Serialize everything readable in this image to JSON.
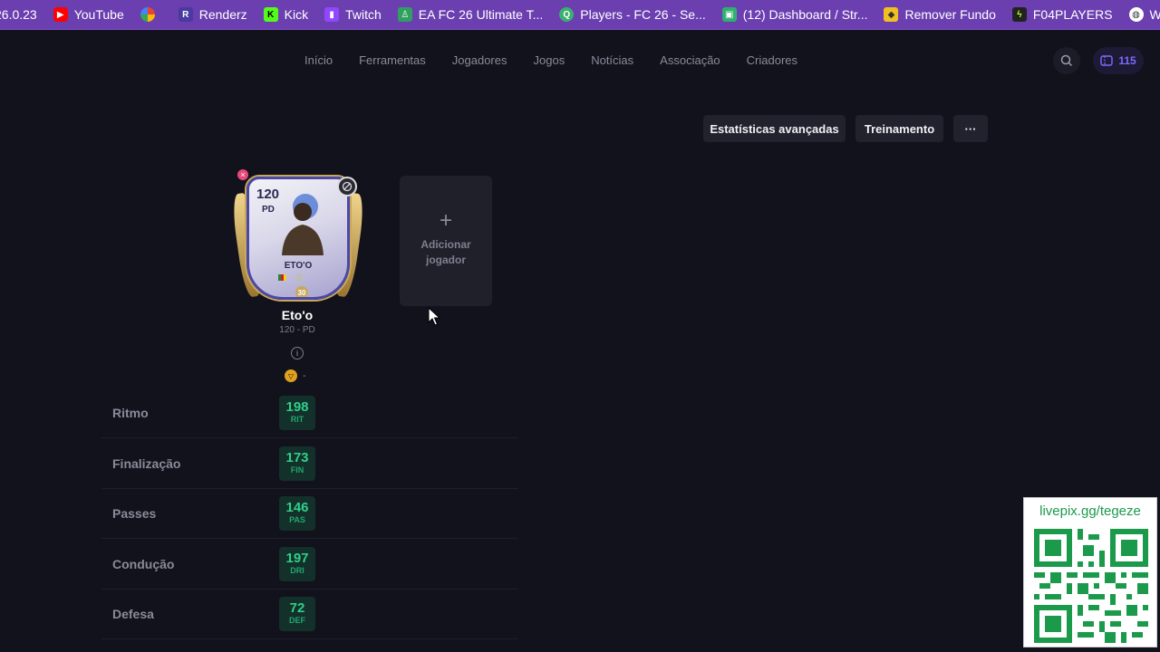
{
  "bookmarks": [
    {
      "label": "26.0.23",
      "icon": "bookmark-icon",
      "color": "#6b3fb0"
    },
    {
      "label": "YouTube",
      "icon": "youtube-icon",
      "color": "#ff0000"
    },
    {
      "label": "",
      "icon": "pinwheel-icon",
      "color": "#e0a020"
    },
    {
      "label": "Renderz",
      "icon": "renderz-icon",
      "color": "#4a3aa0"
    },
    {
      "label": "Kick",
      "icon": "kick-icon",
      "color": "#53fc18"
    },
    {
      "label": "Twitch",
      "icon": "twitch-icon",
      "color": "#9146ff"
    },
    {
      "label": "EA FC 26 Ultimate T...",
      "icon": "ea-icon",
      "color": "#2fa060"
    },
    {
      "label": "Players - FC 26 - Se...",
      "icon": "futbin-icon",
      "color": "#3ab070"
    },
    {
      "label": "(12) Dashboard / Str...",
      "icon": "dashboard-icon",
      "color": "#2fb070"
    },
    {
      "label": "Remover Fundo",
      "icon": "remover-icon",
      "color": "#f0c020"
    },
    {
      "label": "F04PLAYERS",
      "icon": "f04-icon",
      "color": "#222222"
    },
    {
      "label": "Web Ap",
      "icon": "globe-icon",
      "color": "#444444"
    }
  ],
  "nav": {
    "links": [
      "Início",
      "Ferramentas",
      "Jogadores",
      "Jogos",
      "Notícias",
      "Associação",
      "Criadores"
    ],
    "coins": "115"
  },
  "actions": {
    "advanced_stats": "Estatísticas avançadas",
    "training": "Treinamento",
    "more": "···"
  },
  "card": {
    "rating": "120",
    "position": "PD",
    "card_name": "ETO'O",
    "chemistry": "30"
  },
  "player": {
    "name": "Eto'o",
    "subtitle": "120 - PD",
    "chem_style": "-"
  },
  "add_player": {
    "plus": "+",
    "label": "Adicionar jogador"
  },
  "stats": [
    {
      "label": "Ritmo",
      "value": "198",
      "abbr": "RIT"
    },
    {
      "label": "Finalização",
      "value": "173",
      "abbr": "FIN"
    },
    {
      "label": "Passes",
      "value": "146",
      "abbr": "PAS"
    },
    {
      "label": "Condução",
      "value": "197",
      "abbr": "DRI"
    },
    {
      "label": "Defesa",
      "value": "72",
      "abbr": "DEF"
    }
  ],
  "qr": {
    "url": "livepix.gg/tegeze"
  },
  "colors": {
    "background": "#12121c",
    "stat_green": "#2fd08a",
    "bookmarks_bar": "#6b3fb0"
  }
}
